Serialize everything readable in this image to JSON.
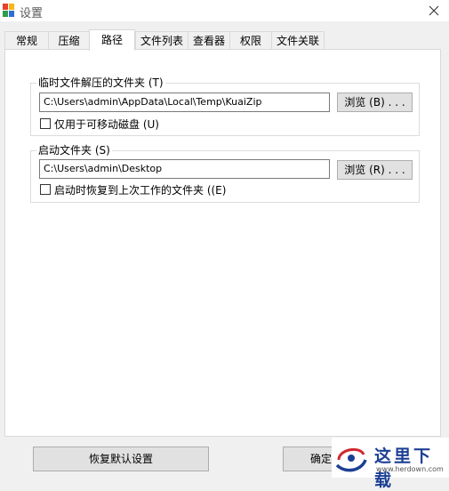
{
  "window": {
    "title": "设置"
  },
  "tabs": [
    {
      "label": "常规",
      "active": false
    },
    {
      "label": "压缩",
      "active": false
    },
    {
      "label": "路径",
      "active": true
    },
    {
      "label": "文件列表",
      "active": false
    },
    {
      "label": "查看器",
      "active": false
    },
    {
      "label": "权限",
      "active": false
    },
    {
      "label": "文件关联",
      "active": false
    }
  ],
  "temp_folder": {
    "label": "临时文件解压的文件夹 (T)",
    "path": "C:\\Users\\admin\\AppData\\Local\\Temp\\KuaiZip",
    "browse_label": "浏览 (B) . . .",
    "checkbox_label": "仅用于可移动磁盘 (U)",
    "checked": false
  },
  "startup_folder": {
    "label": "启动文件夹 (S)",
    "path": "C:\\Users\\admin\\Desktop",
    "browse_label": "浏览 (R) . . .",
    "checkbox_label": "启动时恢复到上次工作的文件夹 ((E)",
    "checked": false
  },
  "footer": {
    "restore_defaults_label": "恢复默认设置",
    "ok_label": "确定"
  },
  "watermark": {
    "text": "这里下载",
    "url": "www.herdown.com"
  }
}
